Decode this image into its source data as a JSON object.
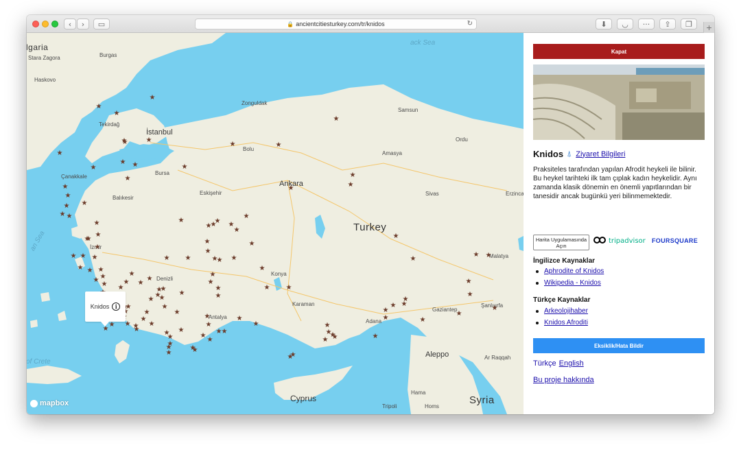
{
  "browser": {
    "url": "ancientcitiesturkey.com/tr/knidos",
    "back_icon": "chevron-left",
    "forward_icon": "chevron-right",
    "sidebar_icon": "sidebar",
    "reload_icon": "reload",
    "download_icon": "download",
    "pocket_icon": "pocket",
    "more_icon": "ellipsis",
    "share_icon": "share",
    "tabs_icon": "tabs",
    "new_tab_label": "+"
  },
  "map": {
    "labels": {
      "bulgaria": "lgaria",
      "stara_zagora": "Stara Zagora",
      "burgas": "Burgas",
      "haskovo": "Haskovo",
      "black_sea": "ack Sea",
      "zonguldak": "Zonguldak",
      "samsun": "Samsun",
      "tekirdag": "Tekirdağ",
      "istanbul": "İstanbul",
      "bolu": "Bolu",
      "ordu": "Ordu",
      "amasya": "Amasya",
      "canakkale": "Çanakkale",
      "bursa": "Bursa",
      "ankara": "Ankara",
      "balikesir": "Balıkesir",
      "eskisehir": "Eskişehir",
      "sivas": "Sivas",
      "erzincan": "Erzinca",
      "turkey": "Turkey",
      "izmir": "İzmir",
      "aegean_sea": "an Sea",
      "denizli": "Denizli",
      "konya": "Konya",
      "malatya": "Malatya",
      "karaman": "Karaman",
      "gaziantep": "Gaziantep",
      "sanliurfa": "Şanlıurfa",
      "antalya": "Antalya",
      "adana": "Adana",
      "aleppo": "Aleppo",
      "ar_raqqah": "Ar Raqqah",
      "crete": "of Crete",
      "cyprus": "Cyprus",
      "syria": "Syria",
      "tripoli": "Tripoli",
      "hama": "Hama",
      "homs": "Homs"
    },
    "popup": {
      "label": "Knidos",
      "icon": "info-icon"
    },
    "attribution": "mapbox",
    "marker_icon": "star"
  },
  "panel": {
    "close_label": "Kapat",
    "title": "Knidos",
    "title_icon": "pin-icon",
    "visit_link": "Ziyaret Bilgileri",
    "description": "Praksiteles tarafından yapılan Afrodit heykeli ile bilinir. Bu heykel tarihteki ilk tam çıplak kadın heykelidir. Aynı zamanda klasik dönemin en önemli yapıtlarından bir tanesidir ancak bugünkü yeri bilinmemektedir.",
    "map_app_button": "Harita Uygulamasında Açın",
    "tripadvisor": "tripadvisor",
    "foursquare": "FOURSQUARE",
    "english_sources_heading": "İngilizce Kaynaklar",
    "english_sources": [
      "Aphrodite of Knidos",
      "Wikipedia - Knidos"
    ],
    "turkish_sources_heading": "Türkçe Kaynaklar",
    "turkish_sources": [
      "Arkeolojihaber",
      "Knidos Afroditi"
    ],
    "report_button": "Eksiklik/Hata Bildir",
    "language_current": "Türkçe",
    "language_alt": "English",
    "about_link": "Bu proje hakkında",
    "colors": {
      "close_button": "#a81c1c",
      "report_button": "#2e90f3",
      "link": "#1a0dab",
      "sea": "#77cfef",
      "land": "#efeee1",
      "marker": "#6b3b2a"
    }
  }
}
